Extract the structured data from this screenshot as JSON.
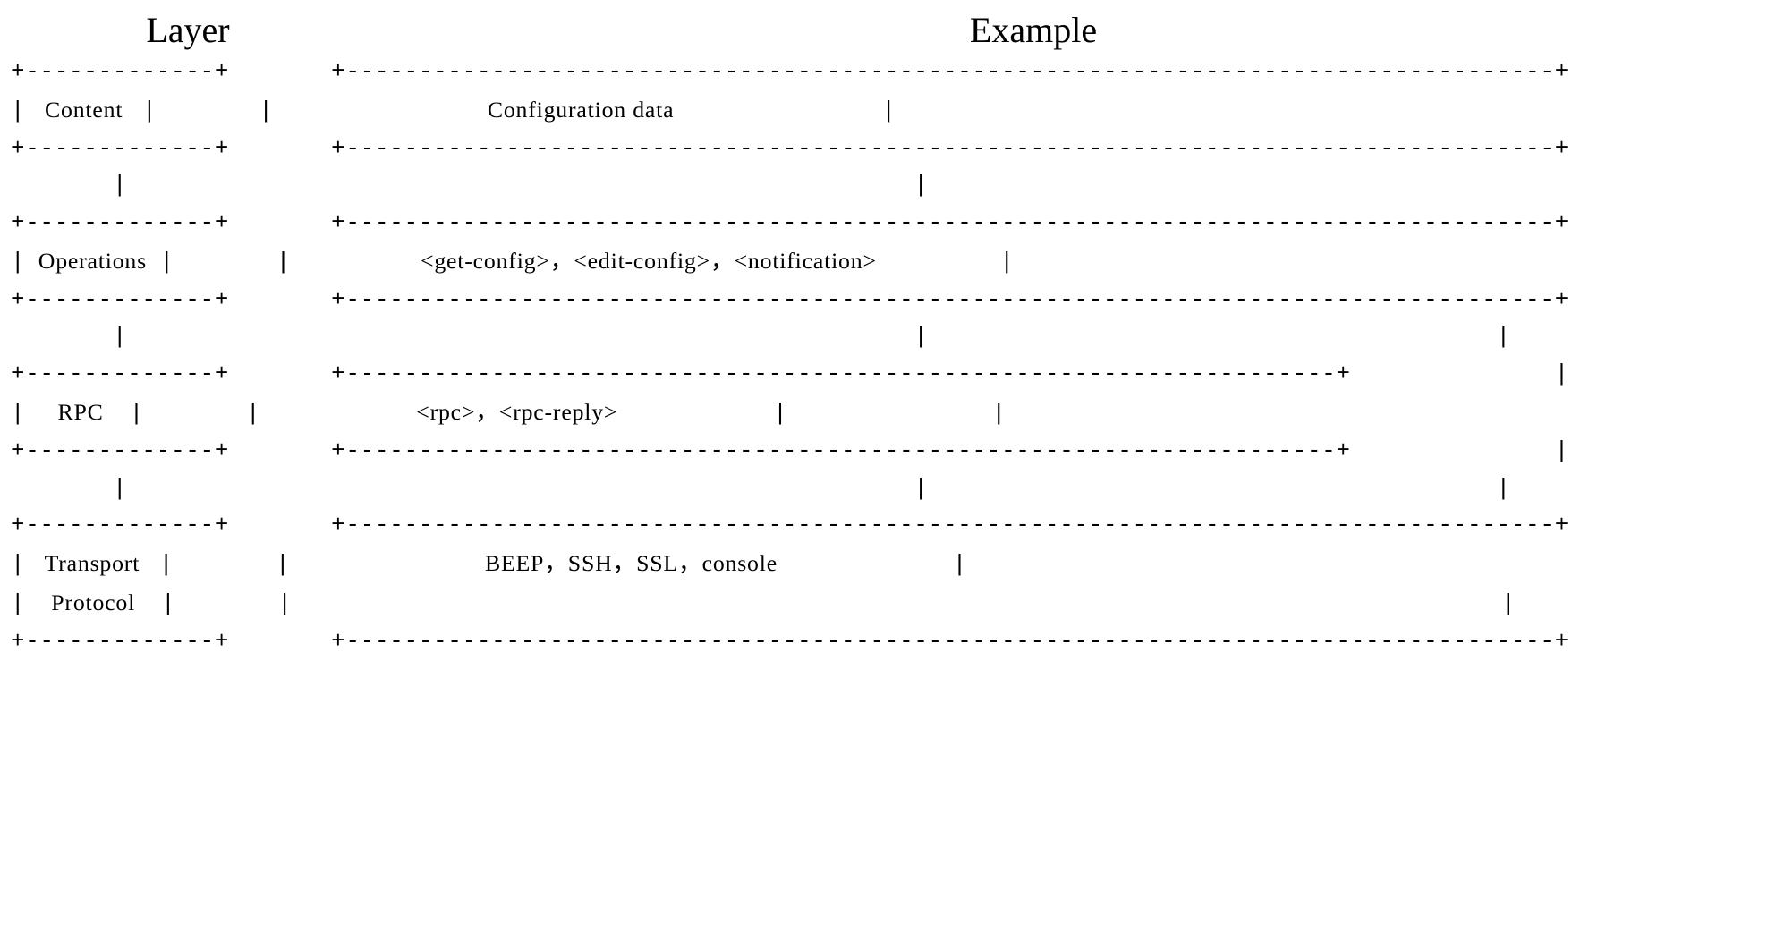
{
  "headings": {
    "layer": "Layer",
    "example": "Example"
  },
  "layers": {
    "content": {
      "label": "Content",
      "example": "Configuration data"
    },
    "operations": {
      "label": "Operations",
      "example": "<get-config>，<edit-config>，<notification>"
    },
    "rpc": {
      "label": "RPC",
      "example": "<rpc>，<rpc-reply>"
    },
    "transport": {
      "label_line1": "Transport",
      "label_line2": "Protocol",
      "example": "BEEP，SSH，SSL，console"
    }
  }
}
